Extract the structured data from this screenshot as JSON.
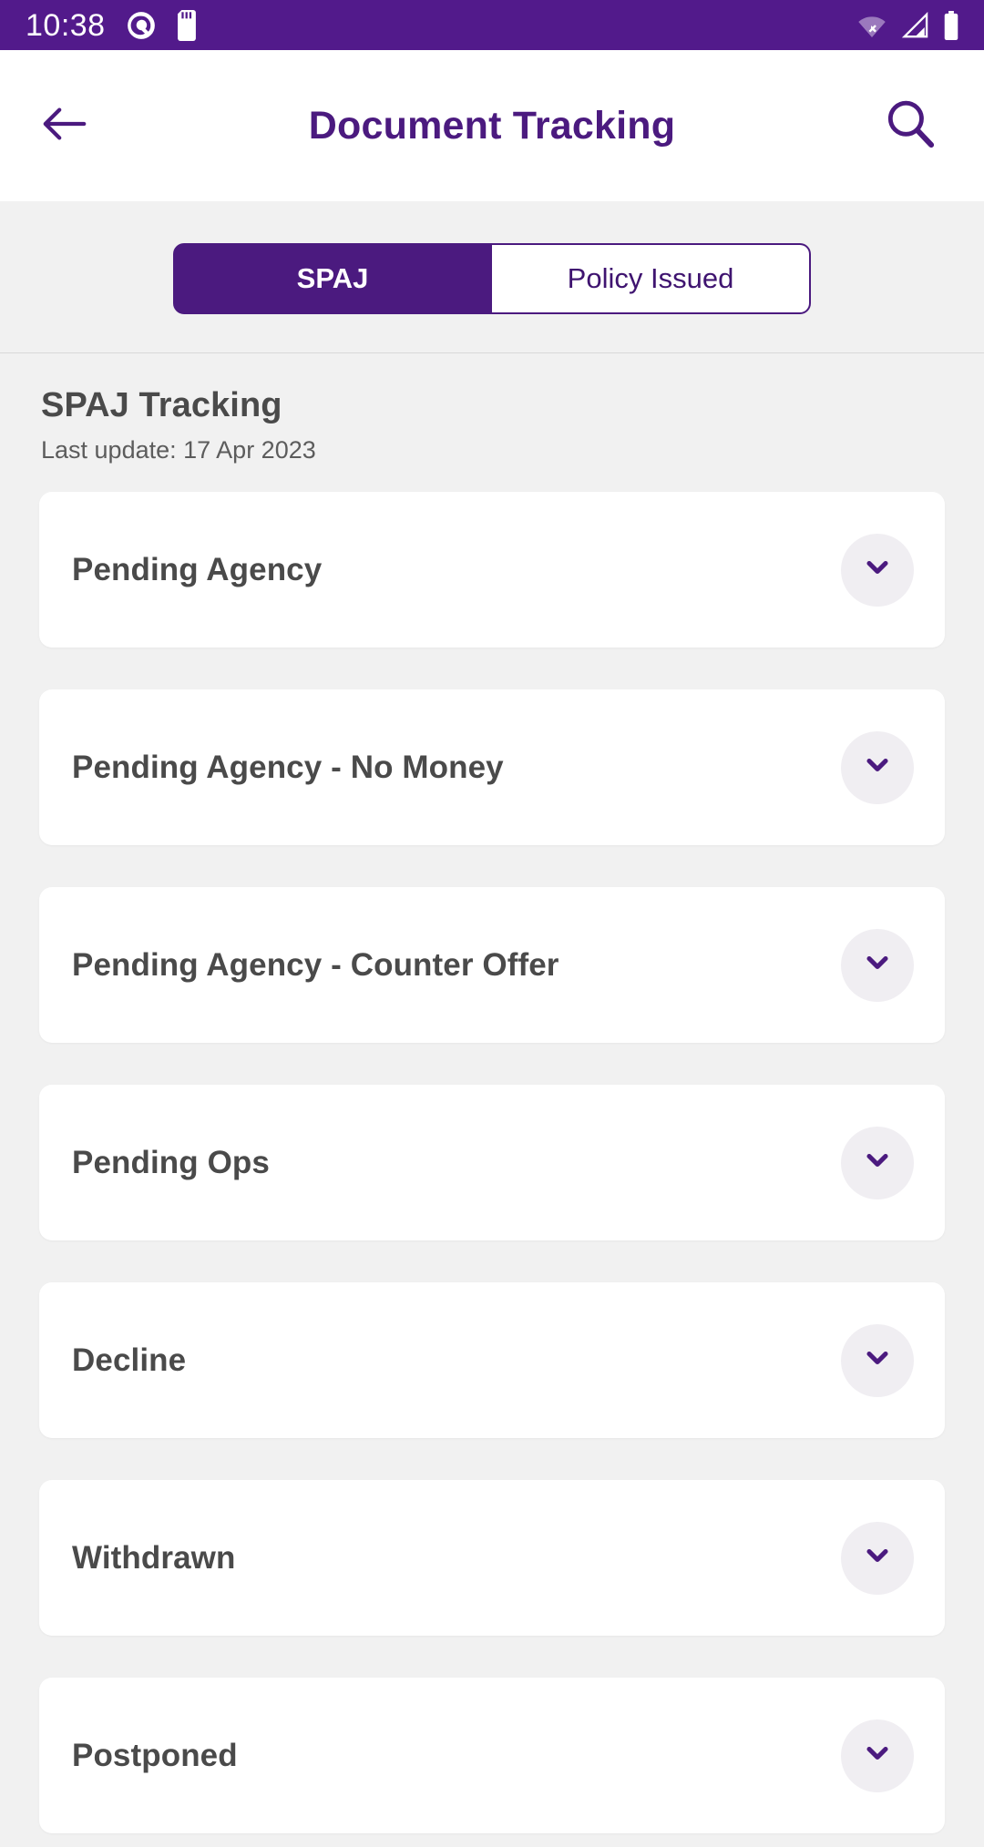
{
  "status_bar": {
    "time": "10:38",
    "left_icons": [
      "android-q-icon",
      "sd-card-icon"
    ],
    "right_icons": [
      "wifi-off-icon",
      "cellular-signal-icon",
      "battery-full-icon"
    ],
    "background_color": "#521A8B"
  },
  "app_bar": {
    "back_icon": "arrow-left-icon",
    "title": "Document Tracking",
    "search_icon": "search-icon",
    "title_color": "#4b1a7f"
  },
  "tabs": {
    "selected_index": 0,
    "items": [
      {
        "label": "SPAJ",
        "selected": true
      },
      {
        "label": "Policy Issued",
        "selected": false
      }
    ],
    "accent_color": "#4b1a7f"
  },
  "section": {
    "title": "SPAJ Tracking",
    "last_update": "Last update: 17 Apr 2023"
  },
  "cards": [
    {
      "label": "Pending Agency",
      "expand_icon": "chevron-down-icon",
      "expanded": false
    },
    {
      "label": "Pending Agency - No Money",
      "expand_icon": "chevron-down-icon",
      "expanded": false
    },
    {
      "label": "Pending Agency - Counter Offer",
      "expand_icon": "chevron-down-icon",
      "expanded": false
    },
    {
      "label": "Pending Ops",
      "expand_icon": "chevron-down-icon",
      "expanded": false
    },
    {
      "label": "Decline",
      "expand_icon": "chevron-down-icon",
      "expanded": false
    },
    {
      "label": "Withdrawn",
      "expand_icon": "chevron-down-icon",
      "expanded": false
    },
    {
      "label": "Postponed",
      "expand_icon": "chevron-down-icon",
      "expanded": false
    }
  ]
}
